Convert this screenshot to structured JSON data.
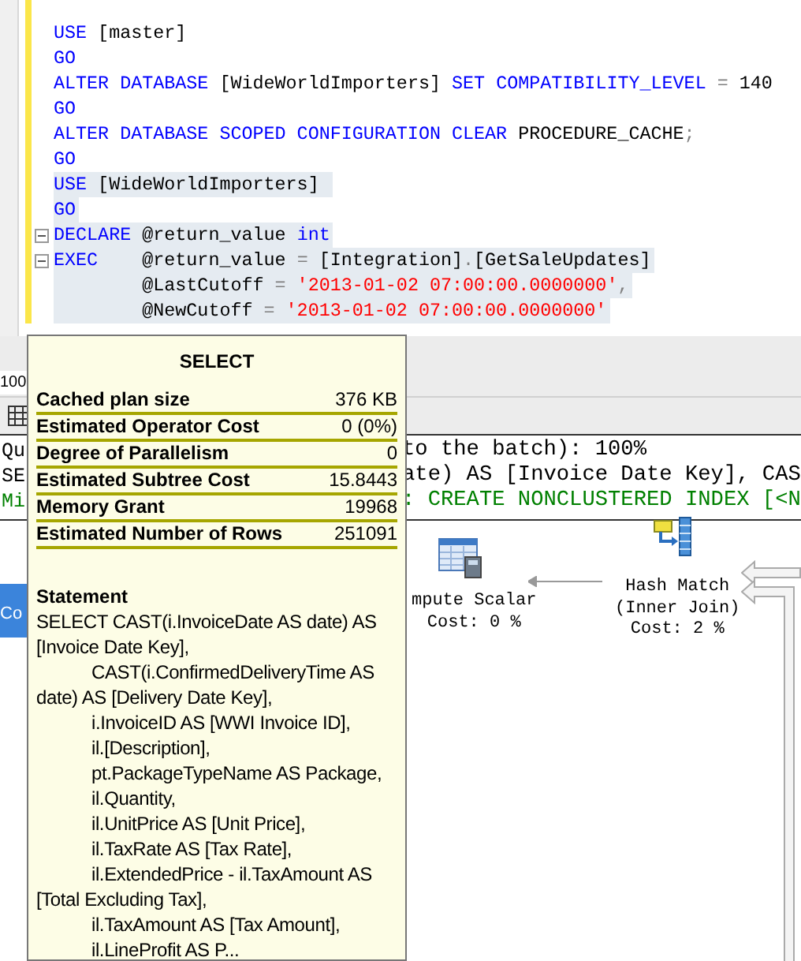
{
  "editor": {
    "lines": [
      {
        "highlighted": false,
        "fold": false,
        "tokens": [
          {
            "kind": "keyword",
            "text": "USE"
          },
          {
            "kind": "plain",
            "text": " [master]"
          }
        ]
      },
      {
        "highlighted": false,
        "fold": false,
        "tokens": [
          {
            "kind": "keyword",
            "text": "GO"
          }
        ]
      },
      {
        "highlighted": false,
        "fold": false,
        "tokens": [
          {
            "kind": "keyword",
            "text": "ALTER DATABASE"
          },
          {
            "kind": "plain",
            "text": " [WideWorldImporters] "
          },
          {
            "kind": "keyword",
            "text": "SET COMPATIBILITY_LEVEL"
          },
          {
            "kind": "operator",
            "text": " = "
          },
          {
            "kind": "plain",
            "text": "140"
          }
        ]
      },
      {
        "highlighted": false,
        "fold": false,
        "tokens": [
          {
            "kind": "keyword",
            "text": "GO"
          }
        ]
      },
      {
        "highlighted": false,
        "fold": false,
        "tokens": [
          {
            "kind": "keyword",
            "text": "ALTER DATABASE SCOPED CONFIGURATION CLEAR"
          },
          {
            "kind": "plain",
            "text": " PROCEDURE_CACHE"
          },
          {
            "kind": "operator",
            "text": ";"
          }
        ]
      },
      {
        "highlighted": false,
        "fold": false,
        "tokens": [
          {
            "kind": "keyword",
            "text": "GO"
          }
        ]
      },
      {
        "highlighted": true,
        "fold": false,
        "tokens": [
          {
            "kind": "keyword",
            "text": "USE"
          },
          {
            "kind": "plain",
            "text": " [WideWorldImporters] "
          }
        ]
      },
      {
        "highlighted": true,
        "fold": false,
        "tokens": [
          {
            "kind": "keyword",
            "text": "GO"
          }
        ]
      },
      {
        "highlighted": true,
        "fold": true,
        "tokens": [
          {
            "kind": "keyword",
            "text": "DECLARE"
          },
          {
            "kind": "plain",
            "text": " @return_value "
          },
          {
            "kind": "keyword",
            "text": "int"
          }
        ]
      },
      {
        "highlighted": true,
        "fold": true,
        "tokens": [
          {
            "kind": "keyword",
            "text": "EXEC"
          },
          {
            "kind": "plain",
            "text": "    @return_value "
          },
          {
            "kind": "operator",
            "text": "="
          },
          {
            "kind": "plain",
            "text": " [Integration]"
          },
          {
            "kind": "operator",
            "text": "."
          },
          {
            "kind": "plain",
            "text": "[GetSaleUpdates]"
          }
        ]
      },
      {
        "highlighted": true,
        "fold": false,
        "tokens": [
          {
            "kind": "plain",
            "text": "        @LastCutoff "
          },
          {
            "kind": "operator",
            "text": "="
          },
          {
            "kind": "string",
            "text": " '2013-01-02 07:00:00.0000000'"
          },
          {
            "kind": "operator",
            "text": ","
          }
        ]
      },
      {
        "highlighted": true,
        "fold": false,
        "tokens": [
          {
            "kind": "plain",
            "text": "        @NewCutoff "
          },
          {
            "kind": "operator",
            "text": "="
          },
          {
            "kind": "string",
            "text": " '2013-01-02 07:00:00.0000000'"
          }
        ]
      }
    ]
  },
  "zoom": "100",
  "messages": [
    {
      "kind": "info",
      "left": "Qu",
      "right": "to the batch): 100%"
    },
    {
      "kind": "info",
      "left": "SE",
      "right": "ate) AS [Invoice Date Key], CAS"
    },
    {
      "kind": "missing_index",
      "left": "Mi",
      "right": ": CREATE NONCLUSTERED INDEX [<N"
    }
  ],
  "plan": {
    "nodes": [
      {
        "kind": "select",
        "selected": true,
        "lines": [
          "Co"
        ]
      },
      {
        "kind": "compute_scalar",
        "selected": false,
        "lines": [
          "mpute Scalar",
          "Cost: 0 %"
        ]
      },
      {
        "kind": "hash_match",
        "selected": false,
        "lines": [
          "Hash Match",
          "(Inner Join)",
          "Cost: 2 %"
        ]
      }
    ]
  },
  "tooltip": {
    "title": "SELECT",
    "rows": [
      {
        "label": "Cached plan size",
        "value": "376 KB"
      },
      {
        "label": "Estimated Operator Cost",
        "value": "0 (0%)"
      },
      {
        "label": "Degree of Parallelism",
        "value": "0"
      },
      {
        "label": "Estimated Subtree Cost",
        "value": "15.8443"
      },
      {
        "label": "Memory Grant",
        "value": "19968"
      },
      {
        "label": "Estimated Number of Rows",
        "value": "251091"
      }
    ],
    "statement_heading": "Statement",
    "statement_lines": [
      {
        "indented": false,
        "text": "SELECT CAST(i.InvoiceDate AS date) AS"
      },
      {
        "indented": false,
        "text": "[Invoice Date Key],"
      },
      {
        "indented": true,
        "text": "CAST(i.ConfirmedDeliveryTime AS"
      },
      {
        "indented": false,
        "text": "date) AS [Delivery Date Key],"
      },
      {
        "indented": true,
        "text": "i.InvoiceID AS [WWI Invoice ID],"
      },
      {
        "indented": true,
        "text": "il.[Description],"
      },
      {
        "indented": true,
        "text": "pt.PackageTypeName AS Package,"
      },
      {
        "indented": true,
        "text": "il.Quantity,"
      },
      {
        "indented": true,
        "text": "il.UnitPrice AS [Unit Price],"
      },
      {
        "indented": true,
        "text": "il.TaxRate AS [Tax Rate],"
      },
      {
        "indented": true,
        "text": "il.ExtendedPrice - il.TaxAmount AS"
      },
      {
        "indented": false,
        "text": "[Total Excluding Tax],"
      },
      {
        "indented": true,
        "text": "il.TaxAmount AS [Tax Amount],"
      },
      {
        "indented": true,
        "text": "il.LineProfit AS P..."
      }
    ]
  }
}
